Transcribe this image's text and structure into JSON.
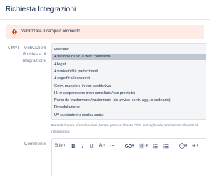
{
  "dialog": {
    "title": "Richiesta Integrazioni"
  },
  "alert": {
    "message": "Valorizzare il campo Commento.",
    "color": "#ffebe6",
    "icon": "error-icon"
  },
  "vmat": {
    "label_line1": "VMAT - Motivazioni",
    "label_line2": "Richiesta di",
    "label_line3": "Integrazione",
    "selected_index": 1,
    "options": [
      "Nessuno",
      "Adesione d'uso a matr convalida",
      "Allegati",
      "Ammissibilità partecipanti",
      "Anagrafica lavoratori",
      "Conv. mansioni in ver. sostitutiva",
      "Ht in sospensione (non conciliate/non previste)",
      "Piano da trasformare/trasformato (da avviso contr. agg. o ordinarie)",
      "Rimodulazione",
      "UP aggiunte in monitoraggio"
    ],
    "help_line1": "Per selezionare più motivazioni, tenere premuto il tasto CTRL e scegliere le motivazioni afferenti all",
    "help_line2": "integrazione."
  },
  "comment": {
    "label": "Commento",
    "toolbar": {
      "style_label": "Stile",
      "bold": "B",
      "italic": "I",
      "underline": "U",
      "text_color": "A"
    }
  }
}
